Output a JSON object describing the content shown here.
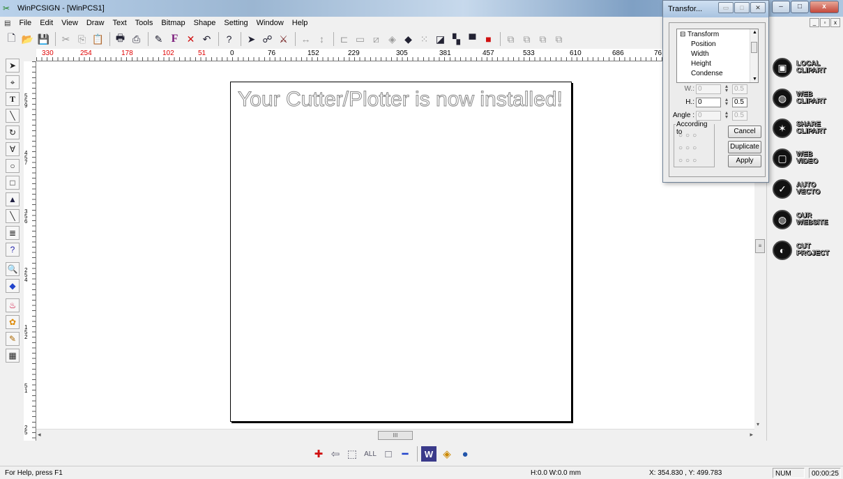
{
  "app": {
    "title": "WinPCSIGN - [WinPCS1]"
  },
  "window_buttons": {
    "minimize": "▭",
    "maximize": "□",
    "close": "X"
  },
  "menu": [
    "File",
    "Edit",
    "View",
    "Draw",
    "Text",
    "Tools",
    "Bitmap",
    "Shape",
    "Setting",
    "Window",
    "Help"
  ],
  "toolbar_icons": [
    "new-icon",
    "open-icon",
    "save-icon",
    "cut-icon",
    "copy-icon",
    "paste-icon",
    "print-icon",
    "cutter-icon",
    "pen-icon",
    "font-icon",
    "delete-icon",
    "undo-icon",
    "help-icon",
    "select-icon",
    "node-icon",
    "knife-icon",
    "flip-horizontal-icon",
    "flip-vertical-icon",
    "align-icon",
    "group-icon"
  ],
  "toolbar": {
    "font_label": "F",
    "delete_label": "✕"
  },
  "ruler": {
    "h_labels": [
      "330",
      "254",
      "178",
      "102",
      "51",
      "0",
      "76",
      "152",
      "229",
      "305",
      "381",
      "457",
      "533",
      "610",
      "686",
      "76"
    ],
    "v_labels": [
      "559",
      "457",
      "356",
      "254",
      "152",
      "51",
      "25"
    ]
  },
  "canvas": {
    "text": "Your Cutter/Plotter is now installed!"
  },
  "right_panel": [
    {
      "line1": "LOCAL",
      "line2": "CLIPART",
      "icon": "folder-icon"
    },
    {
      "line1": "WEB",
      "line2": "CLIPART",
      "icon": "globe-icon"
    },
    {
      "line1": "SHARE",
      "line2": "CLIPART",
      "icon": "share-icon"
    },
    {
      "line1": "WEB",
      "line2": "VIDEO",
      "icon": "video-icon"
    },
    {
      "line1": "AUTO",
      "line2": "VECTO",
      "icon": "check-icon"
    },
    {
      "line1": "OUR",
      "line2": "WEBSITE",
      "icon": "website-icon"
    },
    {
      "line1": "CUT",
      "line2": "PROJECT",
      "icon": "cut-project-icon"
    }
  ],
  "transform_dialog": {
    "title": "Transfor...",
    "tree": {
      "root": "Transform",
      "children": [
        "Position",
        "Width",
        "Height",
        "Condense"
      ]
    },
    "fields": {
      "w_label": "W.:",
      "w_value": "0",
      "w_step": "0.5",
      "h_label": "H.:",
      "h_value": "0",
      "h_step": "0.5",
      "angle_label": "Angle :",
      "angle_value": "0",
      "angle_step": "0.5"
    },
    "according_to": "According to",
    "buttons": {
      "cancel": "Cancel",
      "duplicate": "Duplicate",
      "apply": "Apply"
    }
  },
  "status": {
    "help": "For Help, press F1",
    "size": "H:0.0  W:0.0 mm",
    "coords": "X: 354.830 , Y: 499.783",
    "num": "NUM",
    "time": "00:00:25"
  },
  "scroll_thumb": "III"
}
